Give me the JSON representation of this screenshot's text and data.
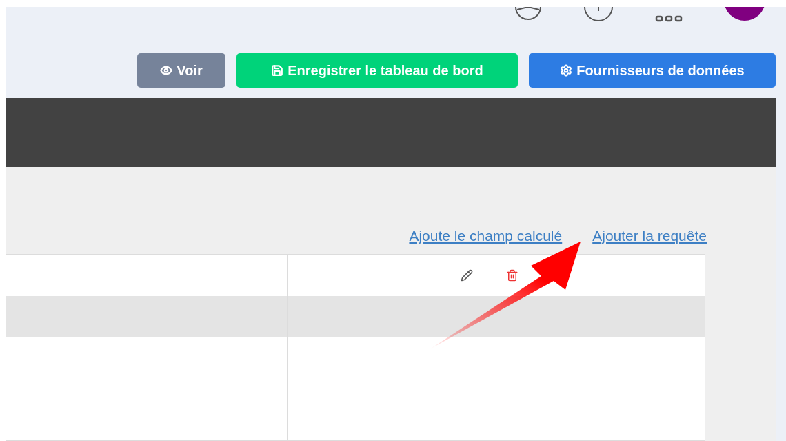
{
  "toolbar": {
    "buttons": [
      {
        "kind": "view",
        "label": "Voir"
      },
      {
        "kind": "save",
        "label": "Enregistrer le tableau de bord"
      },
      {
        "kind": "providers",
        "label": "Fournisseurs de données"
      }
    ]
  },
  "links": [
    {
      "label": "Ajoute le champ calculé"
    },
    {
      "label": "Ajouter la requête"
    }
  ],
  "table": {
    "rows": [
      {
        "kind": "actions"
      },
      {
        "kind": "shaded"
      },
      {
        "kind": "plain"
      }
    ]
  }
}
